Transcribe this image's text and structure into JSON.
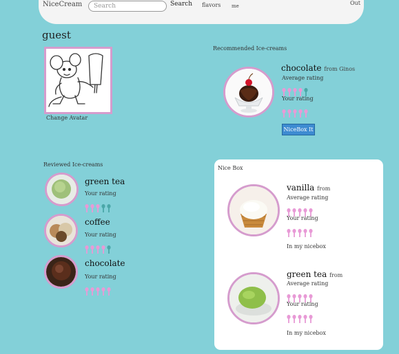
{
  "colors": {
    "background": "#83d0d8",
    "spoon_pink": "#e89ad6",
    "spoon_teal": "#4aa7a8",
    "frame_pink": "#d59ccd",
    "button_blue": "#3d8bd1"
  },
  "nav": {
    "brand": "NiceCream",
    "search_placeholder": "Search",
    "search_label": "Search",
    "flavors": "flavors",
    "me": "me",
    "out": "Out"
  },
  "user": {
    "name": "guest",
    "change_avatar": "Change Avatar"
  },
  "recommended": {
    "title": "Recommended Ice-creams",
    "item": {
      "flavor": "chocolate",
      "from": "from Ginos",
      "avg_label": "Average rating",
      "avg_rating": 4,
      "your_label": "Your rating",
      "your_rating": 5,
      "button": "NiceBox It"
    }
  },
  "reviewed": {
    "title": "Reviewed Ice-creams",
    "items": [
      {
        "flavor": "green tea",
        "rating_label": "Your rating",
        "rating": 3
      },
      {
        "flavor": "coffee",
        "rating_label": "Your rating",
        "rating": 4
      },
      {
        "flavor": "chocolate",
        "rating_label": "Your rating",
        "rating": 5
      }
    ]
  },
  "nicebox": {
    "title": "Nice Box",
    "items": [
      {
        "flavor": "vanilla",
        "from": "from",
        "avg_label": "Average rating",
        "avg_rating": 5,
        "your_label": "Your rating",
        "your_rating": 5,
        "status": "In my nicebox"
      },
      {
        "flavor": "green tea",
        "from": "from",
        "avg_label": "Average rating",
        "avg_rating": 5,
        "your_label": "Your rating",
        "your_rating": 5,
        "status": "In my nicebox"
      }
    ]
  }
}
